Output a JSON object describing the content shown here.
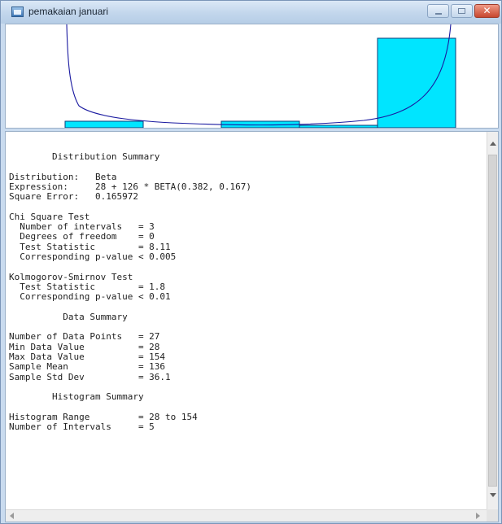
{
  "window": {
    "title": "pemakaian januari"
  },
  "histogram": {
    "fill_color": "#00e5ff",
    "curve_color": "#1a1aa0",
    "bar_heights_relative": [
      0.1,
      0.0,
      0.1,
      0.03,
      1.0
    ]
  },
  "report": {
    "lines": [
      "        Distribution Summary",
      "",
      "Distribution:   Beta",
      "Expression:     28 + 126 * BETA(0.382, 0.167)",
      "Square Error:   0.165972",
      "",
      "Chi Square Test",
      "  Number of intervals   = 3",
      "  Degrees of freedom    = 0",
      "  Test Statistic        = 8.11",
      "  Corresponding p-value < 0.005",
      "",
      "Kolmogorov-Smirnov Test",
      "  Test Statistic        = 1.8",
      "  Corresponding p-value < 0.01",
      "",
      "          Data Summary",
      "",
      "Number of Data Points   = 27",
      "Min Data Value          = 28",
      "Max Data Value          = 154",
      "Sample Mean             = 136",
      "Sample Std Dev          = 36.1",
      "",
      "        Histogram Summary",
      "",
      "Histogram Range         = 28 to 154",
      "Number of Intervals     = 5"
    ]
  }
}
